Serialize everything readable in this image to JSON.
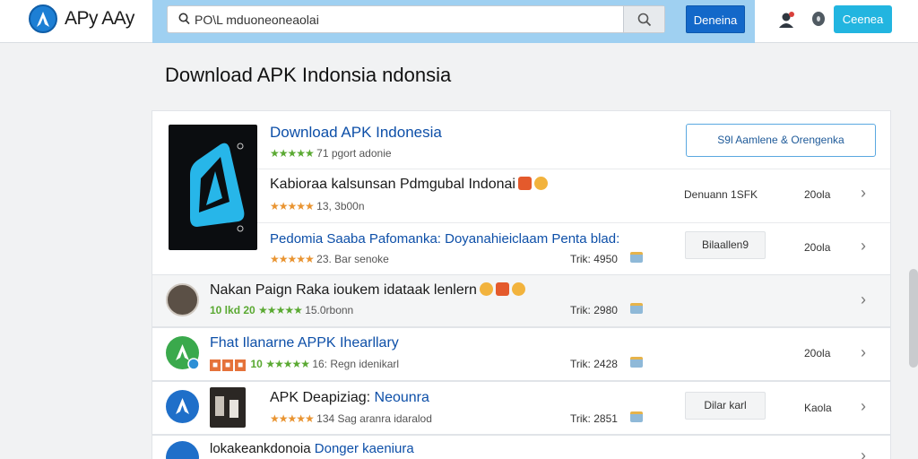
{
  "header": {
    "brand": "APy AAy",
    "search_value": "PO\\L mduoneoneaolai",
    "primary_button": "Deneina",
    "connect_button": "Ceenea"
  },
  "page_title": "Download APK Indonsia ndonsia",
  "featured": {
    "title": "Download APK Indonesia",
    "meta": "71 pgort adonie",
    "action_button": "S9l Aamlene & Orengenka"
  },
  "featured_rows": [
    {
      "title": "Kabioraa kalsunsan Pdmgubal Indonai",
      "meta": "13, 3b00n",
      "col1": "Denuann 1SFK",
      "col2": "20ola"
    },
    {
      "title": "Pedomia Saaba Pafomanka: Doyanahieiclaam Penta blad:",
      "meta": "23. Bar senoke",
      "col1": "Trik: 4950",
      "button": "Bilaallen9",
      "col2": "20ola"
    }
  ],
  "rows": [
    {
      "title": "Nakan Paign Raka ioukem idataak lenlern",
      "tag": "10 lkd 20",
      "meta": "15.0rbonn",
      "col1": "Trik: 2980"
    },
    {
      "title": "Fhat Ilanarne APPK Ihearllary",
      "tag": "10",
      "meta": "16: Regn idenikarl",
      "col1": "Trik: 2428",
      "col2": "20ola"
    },
    {
      "title": "APK Deapiziag:",
      "title_link": "Neounra",
      "meta": "134 Sag aranra idaralod",
      "col1": "Trik: 2851",
      "button": "Dilar karl",
      "col2": "Kaola"
    },
    {
      "title": "lokakeankdonoia",
      "title_link": "Donger kaeniura"
    }
  ],
  "colors": {
    "accent": "#1368c9",
    "connect": "#22b5e0",
    "search_band": "#9fd0f1",
    "star_orange": "#e99431",
    "star_green": "#5aa932"
  }
}
